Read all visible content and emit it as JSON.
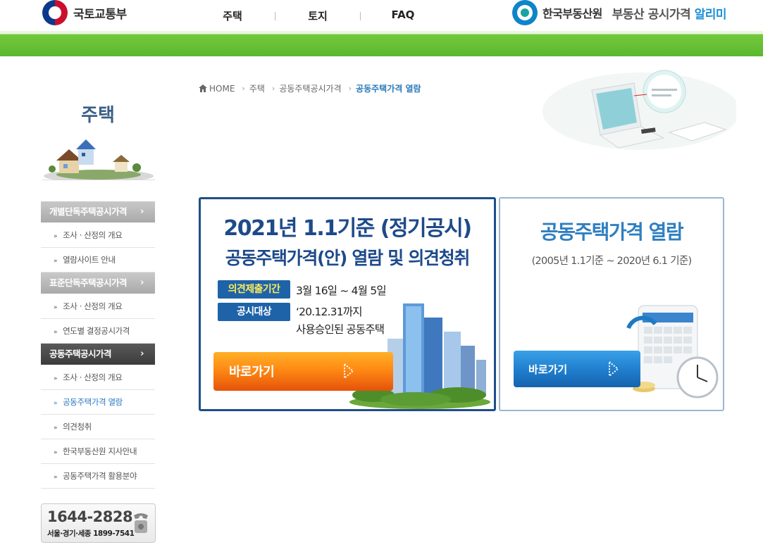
{
  "header": {
    "gov_name": "국토교통부",
    "gnb": [
      {
        "label": "주택"
      },
      {
        "label": "토지"
      },
      {
        "label": "FAQ"
      }
    ],
    "reb_name": "한국부동산원",
    "service_name": "부동산 공시가격",
    "service_accent": "알리미"
  },
  "sidebar": {
    "title": "주택",
    "menu": [
      {
        "label": "개별단독주택공시가격",
        "arrow": "›",
        "active": false,
        "items": [
          "조사 · 산정의 개요",
          "열람사이트 안내"
        ]
      },
      {
        "label": "표준단독주택공시가격",
        "arrow": "›",
        "active": false,
        "items": [
          "조사 · 산정의 개요",
          "연도별 결정공시가격"
        ]
      },
      {
        "label": "공동주택공시가격",
        "arrow": "›",
        "active": true,
        "items": [
          "조사 · 산정의 개요",
          "공동주택가격 열람",
          "의견청취",
          "한국부동산원 지사안내",
          "공동주택가격 활용분야"
        ]
      }
    ],
    "bullet": "»",
    "phone_main": "1644-2828",
    "phone_sub": "서울·경기·세종 1899-7541"
  },
  "breadcrumb": {
    "items": [
      "HOME",
      "주택",
      "공동주택공시가격",
      "공동주택가격 열람"
    ],
    "separator": "›"
  },
  "card_left": {
    "title1": "2021년 1.1기준 (정기공시)",
    "title2": "공동주택가격(안) 열람 및 의견청취",
    "badge1": "의견제출기간",
    "text1": "3월 16일 ~ 4월 5일",
    "badge2": "공시대상",
    "text2": "‘20.12.31까지",
    "text3": "사용승인된 공동주택",
    "button": "바로가기"
  },
  "card_right": {
    "title": "공동주택가격 열람",
    "subtitle": "(2005년 1.1기준 ~ 2020년 6.1 기준)",
    "button": "바로가기"
  },
  "colors": {
    "navy": "#1e4a8a",
    "brand_blue": "#2f7fc0",
    "green_band": "#5bb82e",
    "orange_button": "#ff8a14",
    "current_link": "#2f78c4"
  },
  "icons": [
    "home-icon",
    "phone-icon",
    "arrow-cursor-icon"
  ]
}
